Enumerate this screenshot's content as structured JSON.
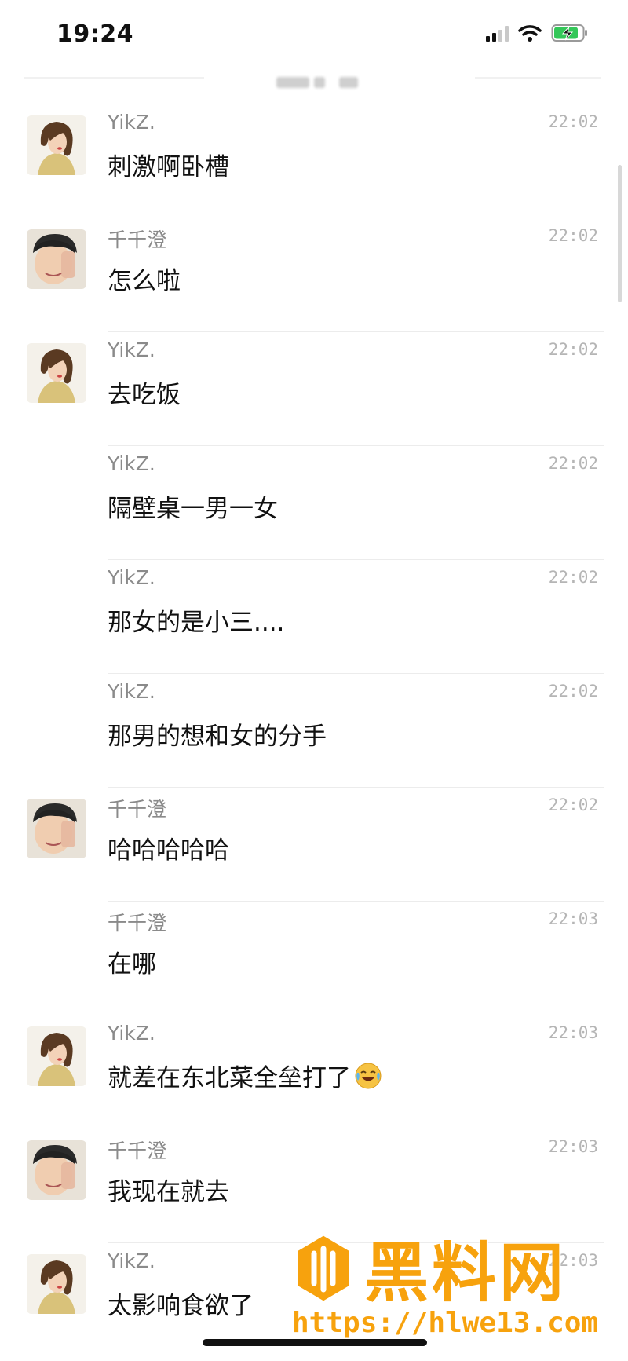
{
  "status_bar": {
    "time": "19:24"
  },
  "messages": [
    {
      "sender": "YikZ.",
      "text": "刺激啊卧槽",
      "time": "22:02",
      "avatar": "belle"
    },
    {
      "sender": "千千澄",
      "text": "怎么啦",
      "time": "22:02",
      "avatar": "boy"
    },
    {
      "sender": "YikZ.",
      "text": "去吃饭",
      "time": "22:02",
      "avatar": "belle"
    },
    {
      "sender": "YikZ.",
      "text": "隔壁桌一男一女",
      "time": "22:02",
      "avatar": ""
    },
    {
      "sender": "YikZ.",
      "text": "那女的是小三....",
      "time": "22:02",
      "avatar": ""
    },
    {
      "sender": "YikZ.",
      "text": "那男的想和女的分手",
      "time": "22:02",
      "avatar": ""
    },
    {
      "sender": "千千澄",
      "text": "哈哈哈哈哈",
      "time": "22:02",
      "avatar": "boy"
    },
    {
      "sender": "千千澄",
      "text": "在哪",
      "time": "22:03",
      "avatar": ""
    },
    {
      "sender": "YikZ.",
      "text": "就差在东北菜全垒打了",
      "time": "22:03",
      "avatar": "belle",
      "emoji": "laughing-crying-emoji"
    },
    {
      "sender": "千千澄",
      "text": "我现在就去",
      "time": "22:03",
      "avatar": "boy"
    },
    {
      "sender": "YikZ.",
      "text": "太影响食欲了",
      "time": "22:03",
      "avatar": "belle"
    }
  ],
  "watermark": {
    "title": "黑料网",
    "url": "https://hlwe13.com"
  }
}
